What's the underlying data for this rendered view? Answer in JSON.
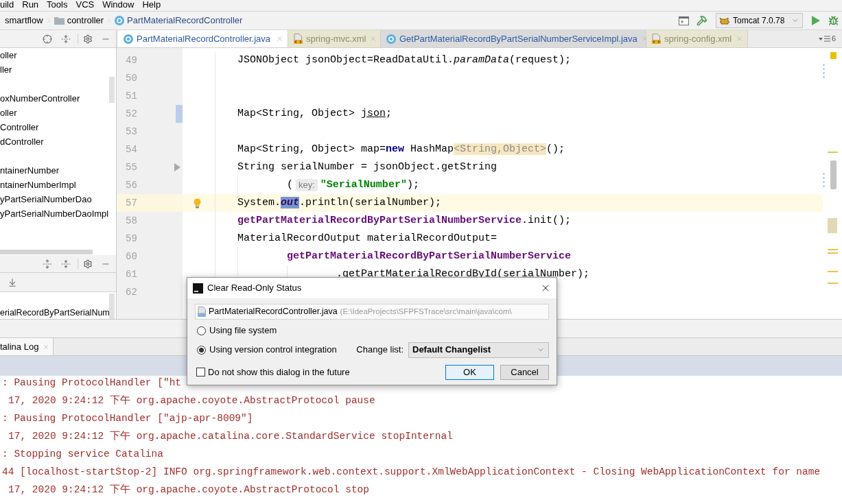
{
  "menu_bar": {
    "items": [
      "uild",
      "Run",
      "Tools",
      "VCS",
      "Window",
      "Help"
    ]
  },
  "navigation_bar": {
    "crumbs": [
      {
        "label": "smartflow",
        "kind": "module"
      },
      {
        "label": "controller",
        "kind": "folder"
      },
      {
        "label": "PartMaterialRecordController",
        "kind": "class"
      }
    ],
    "run_configuration": "Tomcat 7.0.78"
  },
  "project_panel": {
    "groups": [
      {
        "items": [
          "oller",
          "ller"
        ]
      },
      {
        "items": [
          "oxNumberController",
          "oller",
          "Controller",
          "dController"
        ]
      },
      {
        "items": [
          "ntainerNumber",
          "ntainerNumberImpl",
          "yPartSerialNumberDao",
          "yPartSerialNumberDaoImpl"
        ]
      }
    ]
  },
  "structure_panel": {
    "items": [
      "erialRecordByPartSerialNum"
    ]
  },
  "editor_tabs": {
    "tabs": [
      {
        "label": "PartMaterialRecordController.java",
        "kind": "java",
        "selected": true
      },
      {
        "label": "spring-mvc.xml",
        "kind": "xml",
        "selected": false
      },
      {
        "label": "GetPartMaterialRecordByPartSerialNumberServiceImpl.java",
        "kind": "java",
        "selected": false
      },
      {
        "label": "spring-config.xml",
        "kind": "xml",
        "selected": false
      }
    ],
    "hidden_count": "6"
  },
  "editor": {
    "lines": [
      {
        "number": "49",
        "kind": "statement",
        "highlighted": false,
        "modified": false,
        "folded": false,
        "has_quick_fix": false,
        "tokens": [
          {
            "text": "JSONObject jsonObject=ReadDataUtil.",
            "kind": "plain"
          },
          {
            "text": "paramData",
            "kind": "italic"
          },
          {
            "text": "(request);",
            "kind": "plain"
          }
        ]
      },
      {
        "number": "50",
        "highlighted": false,
        "modified": false,
        "folded": false,
        "has_quick_fix": false
      },
      {
        "number": "51",
        "highlighted": false,
        "modified": false,
        "folded": false,
        "has_quick_fix": false
      },
      {
        "number": "52",
        "kind": "statement",
        "highlighted": false,
        "modified": true,
        "folded": false,
        "has_quick_fix": false,
        "tokens": [
          {
            "text": "Map<String, Object> ",
            "kind": "plain"
          },
          {
            "text": "json",
            "kind": "unused"
          },
          {
            "text": ";",
            "kind": "plain"
          }
        ]
      },
      {
        "number": "53",
        "highlighted": false,
        "modified": false,
        "folded": false,
        "has_quick_fix": false
      },
      {
        "number": "54",
        "kind": "statement",
        "highlighted": false,
        "modified": false,
        "folded": false,
        "has_quick_fix": false,
        "tokens": [
          {
            "text": "Map<String, Object> map=",
            "kind": "plain"
          },
          {
            "text": "new",
            "kind": "keyword"
          },
          {
            "text": " HashMap",
            "kind": "plain"
          },
          {
            "text": "<String,Object>",
            "kind": "type-hint"
          },
          {
            "text": "();",
            "kind": "plain"
          }
        ]
      },
      {
        "number": "55",
        "kind": "statement",
        "highlighted": false,
        "modified": false,
        "folded": true,
        "has_quick_fix": false,
        "tokens": [
          {
            "text": "String serialNumber = jsonObject.getString",
            "kind": "plain"
          }
        ]
      },
      {
        "number": "56",
        "kind": "continuation",
        "highlighted": false,
        "modified": false,
        "folded": false,
        "has_quick_fix": false,
        "tokens": [
          {
            "text": "(",
            "kind": "plain"
          },
          {
            "text": "key:",
            "kind": "param-hint"
          },
          {
            "text": "\"SerialNumber\"",
            "kind": "string"
          },
          {
            "text": ");",
            "kind": "plain"
          }
        ]
      },
      {
        "number": "57",
        "kind": "statement",
        "highlighted": true,
        "modified": false,
        "folded": false,
        "has_quick_fix": true,
        "tokens": [
          {
            "text": "System.",
            "kind": "plain"
          },
          {
            "text": "out",
            "kind": "static-selected"
          },
          {
            "text": ".println(serialNumber);",
            "kind": "plain"
          }
        ]
      },
      {
        "number": "58",
        "kind": "statement",
        "highlighted": false,
        "modified": false,
        "folded": false,
        "has_quick_fix": false,
        "tokens": [
          {
            "text": "getPartMaterialRecordByPartSerialNumberService",
            "kind": "field"
          },
          {
            "text": ".init();",
            "kind": "plain"
          }
        ]
      },
      {
        "number": "59",
        "kind": "statement",
        "highlighted": false,
        "modified": false,
        "folded": false,
        "has_quick_fix": false,
        "tokens": [
          {
            "text": "MaterialRecordOutput materialRecordOutput=",
            "kind": "plain"
          }
        ]
      },
      {
        "number": "60",
        "kind": "continuation",
        "highlighted": false,
        "modified": false,
        "folded": false,
        "has_quick_fix": false,
        "tokens": [
          {
            "text": "getPartMaterialRecordByPartSerialNumberService",
            "kind": "field"
          }
        ]
      },
      {
        "number": "61",
        "kind": "deep-continuation",
        "highlighted": false,
        "modified": false,
        "folded": false,
        "has_quick_fix": false,
        "tokens": [
          {
            "text": ".getPartMaterialRecordById(serialNumber);",
            "kind": "plain"
          }
        ]
      },
      {
        "number": "62",
        "highlighted": false,
        "modified": false,
        "folded": false
      }
    ]
  },
  "run_panel": {
    "tabs": [
      {
        "label": "talina Log",
        "selected": true
      }
    ],
    "log_lines": [
      {
        "kind": "message",
        "text": ": Pausing ProtocolHandler [\"ht"
      },
      {
        "kind": "date",
        "text": "17, 2020 9:24:12 下午 org.apache.coyote.AbstractProtocol pause"
      },
      {
        "kind": "message",
        "text": ": Pausing ProtocolHandler [\"ajp-apr-8009\"]"
      },
      {
        "kind": "date",
        "text": "17, 2020 9:24:12 下午 org.apache.catalina.core.StandardService stopInternal"
      },
      {
        "kind": "message",
        "text": ": Stopping service Catalina"
      },
      {
        "kind": "message",
        "text": "44 [localhost-startStop-2] INFO org.springframework.web.context.support.XmlWebApplicationContext - Closing WebApplicationContext for name"
      },
      {
        "kind": "date",
        "text": "17, 2020 9:24:12 下午 org.apache.coyote.AbstractProtocol stop"
      }
    ]
  },
  "dialog": {
    "title": "Clear Read-Only Status",
    "files": [
      {
        "name": "PartMaterialRecordController.java",
        "path": "(E:\\IdeaProjects\\SFPFSTrace\\src\\main\\java\\com\\"
      }
    ],
    "options": [
      {
        "label": "Using file system",
        "selected": false
      },
      {
        "label": "Using version control integration",
        "selected": true
      }
    ],
    "changelist_label": "Change list:",
    "changelist_value": "Default Changelist",
    "dont_show": {
      "label": "Do not show this dialog in the future",
      "checked": false
    },
    "buttons": [
      {
        "label": "OK",
        "default": true
      },
      {
        "label": "Cancel",
        "default": false
      }
    ]
  }
}
